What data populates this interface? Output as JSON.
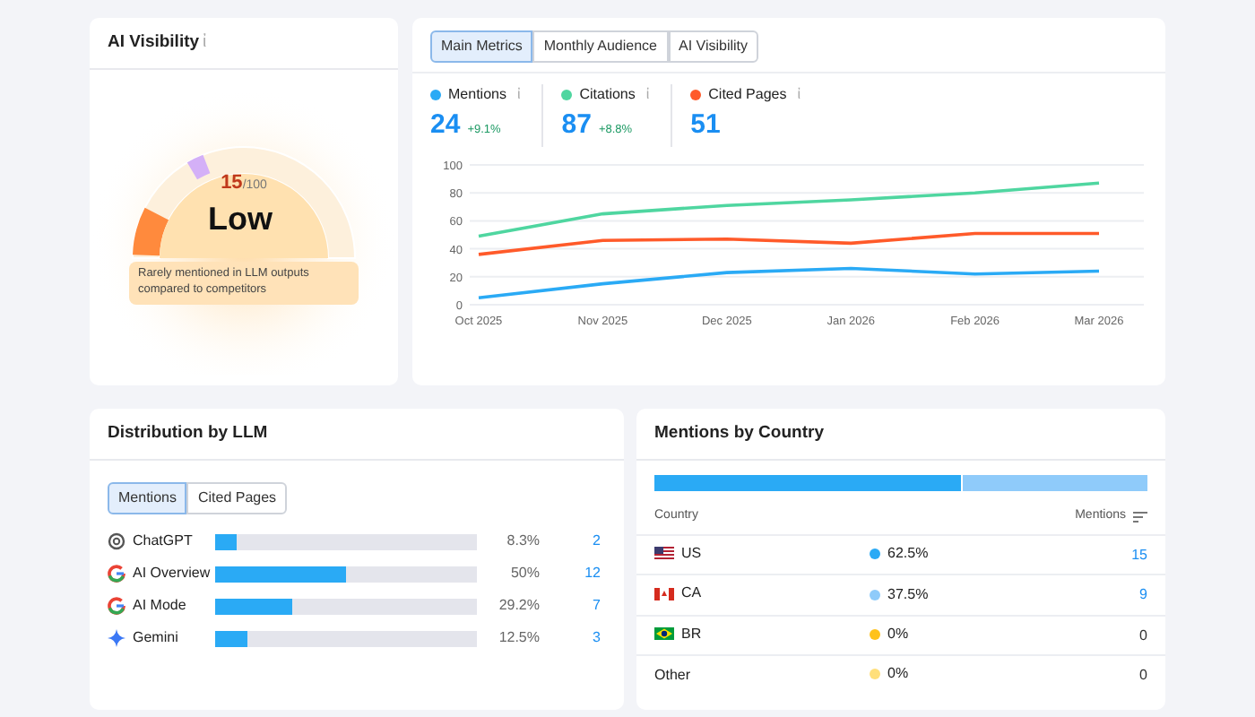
{
  "visibility": {
    "title": "AI Visibility",
    "info": "ἰ",
    "score": "15",
    "max": "/100",
    "rating": "Low",
    "note": "Rarely mentioned in LLM outputs compared to competitors"
  },
  "metrics": {
    "tabs": [
      {
        "label": "Main Metrics",
        "selected": true
      },
      {
        "label": "Monthly Audience",
        "selected": false
      },
      {
        "label": "AI Visibility",
        "selected": false
      }
    ],
    "items": [
      {
        "info": "ἰ",
        "value": "24",
        "change": "+9.1%"
      },
      {
        "info": "ἰ",
        "value": "87",
        "change": "+8.8%"
      },
      {
        "info": "ἰ",
        "value": "51"
      }
    ],
    "chart_data": {
      "type": "line",
      "grid": true,
      "categories": [
        "Oct 2025",
        "Nov 2025",
        "Dec 2025",
        "Jan 2026",
        "Feb 2026",
        "Mar 2026"
      ],
      "ylim": [
        0,
        100
      ],
      "yticks": [
        0,
        20,
        40,
        60,
        80,
        100
      ],
      "series": [
        {
          "name": "Mentions",
          "color": "#2aaaf5",
          "values": [
            5,
            15,
            23,
            26,
            22,
            24
          ]
        },
        {
          "name": "Citations",
          "color": "#4fd6a0",
          "values": [
            49,
            65,
            71,
            75,
            80,
            87
          ]
        },
        {
          "name": "Cited Pages",
          "color": "#ff5a2a",
          "values": [
            36,
            46,
            47,
            44,
            51,
            51
          ]
        }
      ]
    }
  },
  "llm": {
    "title": "Distribution by LLM",
    "tabs": [
      {
        "label": "Mentions",
        "selected": true
      },
      {
        "label": "Cited Pages",
        "selected": false
      }
    ],
    "rows": [
      {
        "kind": "chatgpt",
        "name": "ChatGPT",
        "level": 0.083,
        "percent": "8.3%",
        "count": "2"
      },
      {
        "kind": "google",
        "name": "AI Overview",
        "level": 0.5,
        "percent": "50%",
        "count": "12"
      },
      {
        "kind": "google",
        "name": "AI Mode",
        "level": 0.292,
        "percent": "29.2%",
        "count": "7"
      },
      {
        "kind": "gemini",
        "name": "Gemini",
        "level": 0.125,
        "percent": "12.5%",
        "count": "3"
      }
    ]
  },
  "countries": {
    "title": "Mentions by Country",
    "columns": [
      "Country",
      "Mentions"
    ],
    "rows": [
      {
        "kind": "us",
        "code": "US",
        "color": "#2aaaf5",
        "percent": "62.5%",
        "count": "15",
        "link": true
      },
      {
        "kind": "ca",
        "code": "CA",
        "color": "#8fcbfa",
        "percent": "37.5%",
        "count": "9",
        "link": true
      },
      {
        "kind": "br",
        "code": "BR",
        "color": "#ffc21a",
        "percent": "0%",
        "count": "0",
        "link": false
      },
      {
        "kind": "other",
        "code": "Other",
        "color": "#ffdf7a",
        "percent": "0%",
        "count": "0",
        "link": false
      }
    ]
  }
}
